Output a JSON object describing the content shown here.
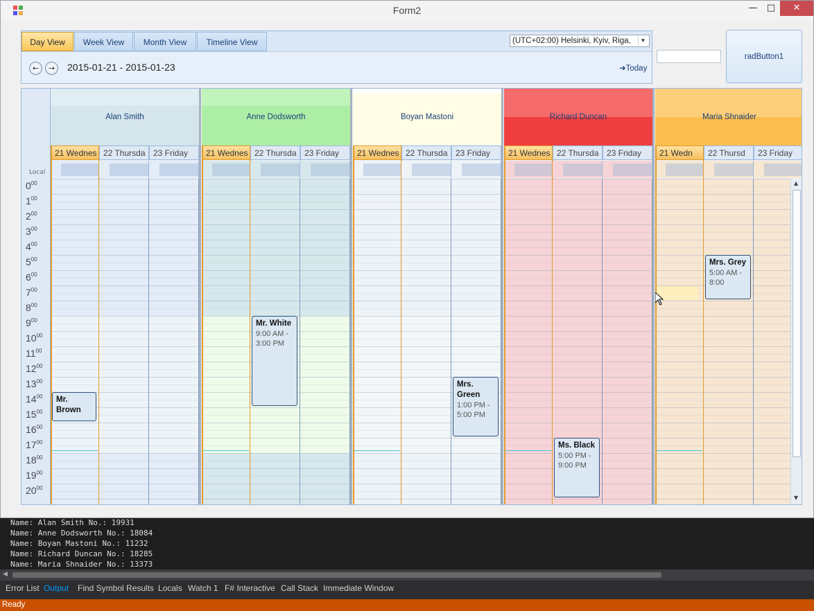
{
  "window": {
    "title": "Form2"
  },
  "nav": {
    "tabs": [
      {
        "label": "Day View",
        "active": true
      },
      {
        "label": "Week View",
        "active": false
      },
      {
        "label": "Month View",
        "active": false
      },
      {
        "label": "Timeline View",
        "active": false
      }
    ],
    "timezone": "(UTC+02:00) Helsinki, Kyiv, Riga,",
    "date_range": "2015-01-21 - 2015-01-23",
    "today_label": "Today",
    "prev_icon": "arrow-left-icon",
    "next_icon": "arrow-right-icon"
  },
  "side": {
    "textbox_value": "",
    "button_label": "radButton1"
  },
  "scheduler": {
    "local_label": "Local",
    "hours": [
      "0",
      "1",
      "2",
      "3",
      "4",
      "5",
      "6",
      "7",
      "8",
      "9",
      "10",
      "11",
      "12",
      "13",
      "14",
      "15",
      "16",
      "17",
      "18",
      "19",
      "20"
    ],
    "minutes_label": "00",
    "resources": [
      {
        "name": "Alan Smith",
        "header_color": "#dbe9ef",
        "col_color": "#e3ecf7",
        "work_color": "#eef3f7",
        "days": [
          "21 Wednes",
          "22 Thursda",
          "23 Friday"
        ]
      },
      {
        "name": "Anne Dodsworth",
        "header_color": "#b4f2b0",
        "col_color": "#d7e8ec",
        "work_color": "#eefbe9",
        "days": [
          "21 Wednes",
          "22 Thursda",
          "23 Friday"
        ]
      },
      {
        "name": "Boyan Mastoni",
        "header_color": "#fffde8",
        "col_color": "#eef3f7",
        "work_color": "#f2f6f8",
        "days": [
          "21 Wednes",
          "22 Thursda",
          "23 Friday"
        ]
      },
      {
        "name": "Richard Duncan",
        "header_color": "#f24d4d",
        "col_color": "#f6d3d6",
        "work_color": "#f6d3d6",
        "days": [
          "21 Wednes",
          "22 Thursda",
          "23 Friday"
        ]
      },
      {
        "name": "Maria Shnaider",
        "header_color": "#fbc460",
        "col_color": "#f6e6d2",
        "work_color": "#f6e6d2",
        "days": [
          "21 Wedn",
          "22 Thursd",
          "23 Friday"
        ]
      }
    ],
    "appointments": [
      {
        "title": "Mr. Brown",
        "time": "",
        "resource": 0,
        "day": 0,
        "start": 14.0,
        "end": 16.0
      },
      {
        "title": "Mr. White",
        "time": "9:00 AM - 3:00 PM",
        "resource": 1,
        "day": 1,
        "start": 9.0,
        "end": 15.0
      },
      {
        "title": "Mrs. Green",
        "time": "1:00 PM - 5:00 PM",
        "resource": 2,
        "day": 2,
        "start": 13.0,
        "end": 17.0
      },
      {
        "title": "Ms. Black",
        "time": "5:00 PM - 9:00 PM",
        "resource": 3,
        "day": 1,
        "start": 17.0,
        "end": 21.0
      },
      {
        "title": "Mrs. Grey",
        "time": "5:00 AM - 8:00",
        "resource": 4,
        "day": 1,
        "start": 5.0,
        "end": 8.0
      }
    ]
  },
  "output": {
    "lines": [
      "Name: Alan Smith No.: 19931",
      "Name: Anne Dodsworth No.: 18084",
      "Name: Boyan Mastoni No.: 11232",
      "Name: Richard Duncan No.: 18285",
      "Name: Maria Shnaider No.: 13373"
    ]
  },
  "tool_tabs": [
    {
      "label": "Error List",
      "active": false
    },
    {
      "label": "Output",
      "active": true
    },
    {
      "label": "Find Symbol Results",
      "active": false
    },
    {
      "label": "Locals",
      "active": false
    },
    {
      "label": "Watch 1",
      "active": false
    },
    {
      "label": "F# Interactive",
      "active": false
    },
    {
      "label": "Call Stack",
      "active": false
    },
    {
      "label": "Immediate Window",
      "active": false
    }
  ],
  "status": {
    "text": "Ready"
  }
}
